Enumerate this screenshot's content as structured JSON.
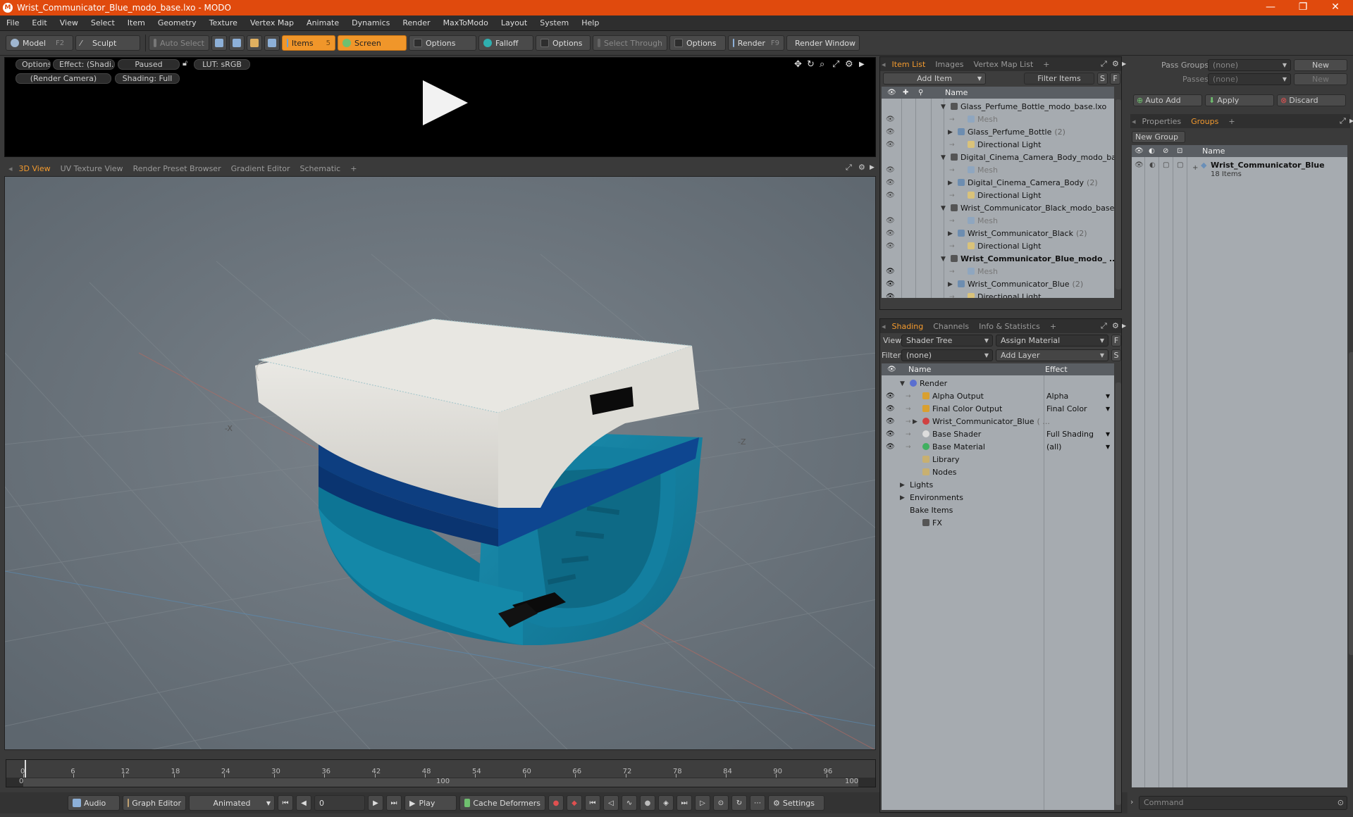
{
  "window": {
    "title": "Wrist_Communicator_Blue_modo_base.lxo - MODO",
    "app_icon": "modo-logo",
    "minimize": "—",
    "restore": "❐",
    "close": "✕"
  },
  "menu": [
    "File",
    "Edit",
    "View",
    "Select",
    "Item",
    "Geometry",
    "Texture",
    "Vertex Map",
    "Animate",
    "Dynamics",
    "Render",
    "MaxToModo",
    "Layout",
    "System",
    "Help"
  ],
  "toolbar": {
    "model": "Model",
    "model_key": "F2",
    "sculpt": "Sculpt",
    "auto_select": "Auto Select",
    "items": "Items",
    "items_key": "5",
    "screen": "Screen",
    "options1": "Options",
    "falloff": "Falloff",
    "options2": "Options",
    "select_through": "Select Through",
    "options3": "Options",
    "render": "Render",
    "render_key": "F9",
    "render_window": "Render Window"
  },
  "preview": {
    "options": "Options",
    "effect": "Effect: (Shadi...",
    "paused": "Paused",
    "lut": "LUT: sRGB",
    "camera": "(Render Camera)",
    "shading": "Shading: Full"
  },
  "viewport_tabs": [
    "3D View",
    "UV Texture View",
    "Render Preset Browser",
    "Gradient Editor",
    "Schematic",
    "+"
  ],
  "viewport": {
    "axis_neg_x": "-X",
    "axis_neg_z": "-Z"
  },
  "timeline": {
    "ticks": [
      "0",
      "6",
      "12",
      "18",
      "24",
      "30",
      "36",
      "42",
      "48",
      "54",
      "60",
      "66",
      "72",
      "78",
      "84",
      "90",
      "96"
    ],
    "range_start": "0",
    "range_mid": "100",
    "range_end": "100"
  },
  "bottombar": {
    "audio": "Audio",
    "graph_editor": "Graph Editor",
    "animated": "Animated",
    "frame": "0",
    "play": "Play",
    "cache_deformers": "Cache Deformers",
    "settings": "Settings"
  },
  "item_list": {
    "tabs": [
      "Item List",
      "Images",
      "Vertex Map List",
      "+"
    ],
    "add_item": "Add Item",
    "filter_items": "Filter Items",
    "s": "S",
    "f": "F",
    "col_name": "Name",
    "rows": [
      {
        "label": "Glass_Perfume_Bottle_modo_base.lxo",
        "level": 0,
        "expander": "▼",
        "count": ""
      },
      {
        "label": "Mesh",
        "level": 2,
        "expander": "",
        "count": "",
        "dim": true
      },
      {
        "label": "Glass_Perfume_Bottle",
        "level": 1,
        "expander": "▶",
        "count": "(2)"
      },
      {
        "label": "Directional Light",
        "level": 2,
        "expander": "",
        "count": ""
      },
      {
        "label": "Digital_Cinema_Camera_Body_modo_bas ...",
        "level": 0,
        "expander": "▼",
        "count": ""
      },
      {
        "label": "Mesh",
        "level": 2,
        "expander": "",
        "count": "",
        "dim": true
      },
      {
        "label": "Digital_Cinema_Camera_Body",
        "level": 1,
        "expander": "▶",
        "count": "(2)"
      },
      {
        "label": "Directional Light",
        "level": 2,
        "expander": "",
        "count": ""
      },
      {
        "label": "Wrist_Communicator_Black_modo_base.lxo",
        "level": 0,
        "expander": "▼",
        "count": ""
      },
      {
        "label": "Mesh",
        "level": 2,
        "expander": "",
        "count": "",
        "dim": true
      },
      {
        "label": "Wrist_Communicator_Black",
        "level": 1,
        "expander": "▶",
        "count": "(2)"
      },
      {
        "label": "Directional Light",
        "level": 2,
        "expander": "",
        "count": ""
      },
      {
        "label": "Wrist_Communicator_Blue_modo_ ...",
        "level": 0,
        "expander": "▼",
        "count": "",
        "bold": true
      },
      {
        "label": "Mesh",
        "level": 2,
        "expander": "",
        "count": "",
        "dim": true
      },
      {
        "label": "Wrist_Communicator_Blue",
        "level": 1,
        "expander": "▶",
        "count": "(2)"
      },
      {
        "label": "Directional Light",
        "level": 2,
        "expander": "",
        "count": ""
      }
    ]
  },
  "shading": {
    "tabs": [
      "Shading",
      "Channels",
      "Info & Statistics",
      "+"
    ],
    "view_label": "View",
    "view_value": "Shader Tree",
    "assign_material": "Assign Material",
    "f": "F",
    "filter_label": "Filter",
    "filter_value": "(none)",
    "add_layer": "Add Layer",
    "s": "S",
    "col_name": "Name",
    "col_effect": "Effect",
    "rows": [
      {
        "label": "Render",
        "level": 0,
        "expander": "▼",
        "effect": "",
        "eye": false,
        "icon": "render"
      },
      {
        "label": "Alpha Output",
        "level": 1,
        "expander": "",
        "effect": "Alpha",
        "eye": true,
        "icon": "output"
      },
      {
        "label": "Final Color Output",
        "level": 1,
        "expander": "",
        "effect": "Final Color",
        "eye": true,
        "icon": "output"
      },
      {
        "label": "Wrist_Communicator_Blue",
        "level": 1,
        "expander": "▶",
        "effect": "",
        "eye": true,
        "icon": "material",
        "suffix": "( ..."
      },
      {
        "label": "Base Shader",
        "level": 1,
        "expander": "",
        "effect": "Full Shading",
        "eye": true,
        "icon": "shader"
      },
      {
        "label": "Base Material",
        "level": 1,
        "expander": "",
        "effect": "(all)",
        "eye": true,
        "icon": "basemat"
      },
      {
        "label": "Library",
        "level": 1,
        "expander": "",
        "effect": "",
        "eye": false,
        "icon": "folder"
      },
      {
        "label": "Nodes",
        "level": 1,
        "expander": "",
        "effect": "",
        "eye": false,
        "icon": "folder"
      },
      {
        "label": "Lights",
        "level": 0,
        "expander": "▶",
        "effect": "",
        "eye": false,
        "icon": ""
      },
      {
        "label": "Environments",
        "level": 0,
        "expander": "▶",
        "effect": "",
        "eye": false,
        "icon": ""
      },
      {
        "label": "Bake Items",
        "level": 0,
        "expander": "",
        "effect": "",
        "eye": false,
        "icon": ""
      },
      {
        "label": "FX",
        "level": 1,
        "expander": "",
        "effect": "",
        "eye": false,
        "icon": "fx"
      }
    ]
  },
  "groups": {
    "pass_groups_label": "Pass Groups",
    "pass_groups_value": "(none)",
    "passes_label": "Passes",
    "passes_value": "(none)",
    "new": "New",
    "new2": "New",
    "auto_add": "Auto Add",
    "apply": "Apply",
    "discard": "Discard",
    "tabs": [
      "Properties",
      "Groups",
      "+"
    ],
    "new_group": "New Group",
    "col_name": "Name",
    "group_name": "Wrist_Communicator_Blue",
    "group_count": "18 Items"
  },
  "command": {
    "placeholder": "Command"
  },
  "colors": {
    "title_bar": "#e04a0d",
    "accent": "#f39a2e",
    "viewport_bg": "#6f7880",
    "band_teal": "#1b8fb0",
    "band_navy": "#0d3e80",
    "face_white": "#e8e7e2"
  }
}
